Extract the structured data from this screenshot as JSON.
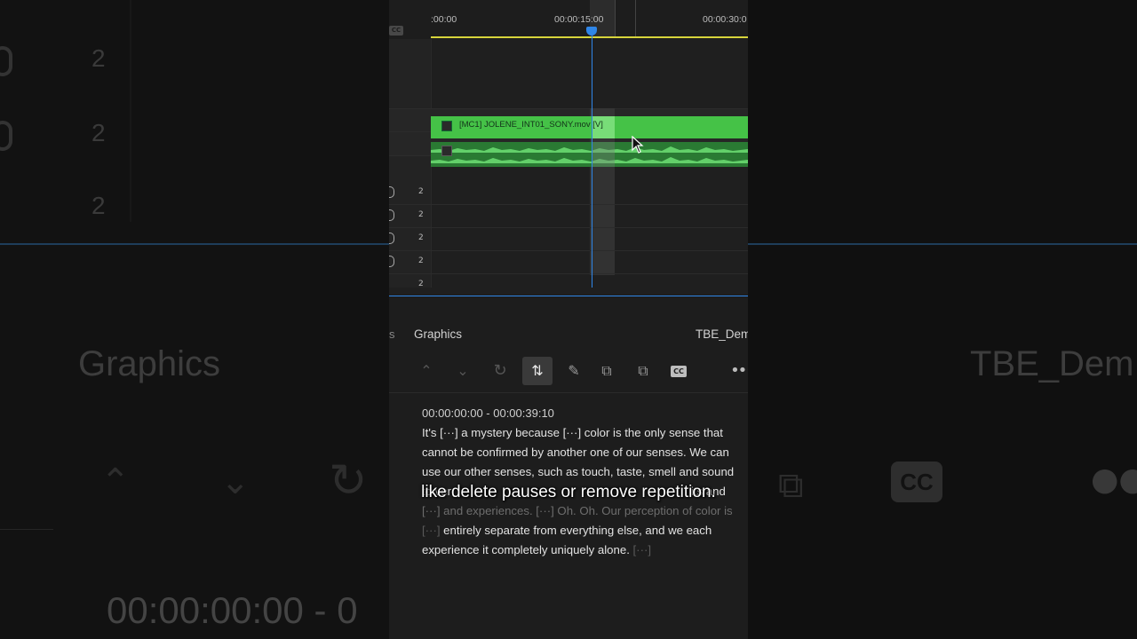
{
  "timeline": {
    "ruler_ticks": [
      ":00:00",
      "00:00:15:00",
      "00:00:30:0"
    ],
    "cc_label": "CC",
    "clip_name": "[MC1] JOLENE_INT01_SONY.mov [V]",
    "track_numbers": [
      "2",
      "2",
      "2",
      "2",
      "2"
    ],
    "track_last": "2"
  },
  "background": {
    "numbers": [
      "2",
      "2",
      "2"
    ],
    "graphics_label": "Graphics",
    "sequence_label": "TBE_Dem",
    "cc_label": "CC",
    "timecode": "00:00:00:00 - 0"
  },
  "panel": {
    "partial_tab": "s",
    "graphics_tab": "Graphics",
    "sequence_name": "TBE_Dem"
  },
  "toolbar": {
    "icons": [
      "chevron-up-icon",
      "chevron-down-icon",
      "refresh-icon",
      "align-icon",
      "pencil-icon",
      "split-icon",
      "merge-icon",
      "cc-icon",
      "more-icon"
    ],
    "cc_label": "CC",
    "more_label": "•••"
  },
  "transcript": {
    "timestamp": "00:00:00:00 - 00:00:39:10",
    "line1": "It's [···] a mystery because [···] color is the only sense that",
    "line2": "cannot be confirmed by another one of our senses. We can",
    "line3": "use our other senses, such as touch, taste, smell and sound",
    "line4_start": "to ver",
    "line4_end": "its and",
    "line5": "[···] and experiences. [···] Oh. Oh. Our perception of color is",
    "line6_pause": "[···]",
    "line6": " entirely separate from everything else, and we each",
    "line7": "experience it completely uniquely alone.",
    "line7_pause": " [···]"
  },
  "caption": "like delete pauses or remove repetition."
}
